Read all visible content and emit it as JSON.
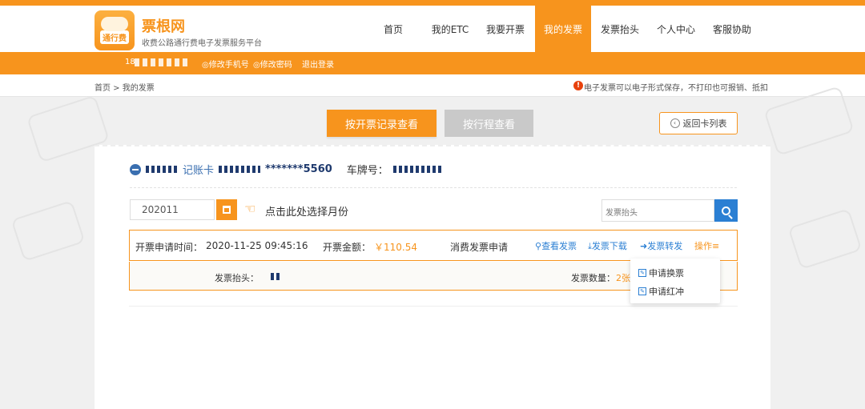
{
  "header": {
    "logo_text": "通行费",
    "brand": "票根网",
    "slogan": "收费公路通行费电子发票服务平台",
    "nav": [
      "首页",
      "我的ETC",
      "我要开票",
      "我的发票",
      "发票抬头",
      "个人中心",
      "客服协助"
    ],
    "active_nav": "我的发票"
  },
  "subbar": {
    "phone_prefix": "18",
    "change_phone": "◎修改手机号",
    "change_password": "◎修改密码",
    "logout": "退出登录"
  },
  "breadcrumb": {
    "text": "首页 > 我的发票"
  },
  "notice": {
    "icon": "!",
    "text": "电子发票可以电子形式保存，不打印也可报销、抵扣"
  },
  "buttons": {
    "by_record": "按开票记录查看",
    "by_trip": "按行程查看",
    "back": "返回卡列表"
  },
  "card_info": {
    "type": "记账卡",
    "number_suffix": "*******5560",
    "plate_label": "车牌号："
  },
  "filter": {
    "month_value": "202011",
    "hint": "点击此处选择月份",
    "search_placeholder": "发票抬头"
  },
  "record": {
    "apply_time_label": "开票申请时间：",
    "apply_time": "2020-11-25 09:45:16",
    "amount_label": "开票金额：",
    "amount": "￥110.54",
    "type": "消费发票申请",
    "actions": {
      "view": "查看发票",
      "download": "发票下载",
      "forward": "发票转发",
      "operate": "操作"
    },
    "title_label": "发票抬头：",
    "count_label": "发票数量：",
    "count_value": "2张"
  },
  "dropdown": {
    "items": [
      "申请换票",
      "申请红冲"
    ]
  },
  "colors": {
    "brand_orange": "#f7941d",
    "link_blue": "#2b7fd3",
    "button_gray": "#c9c9c9"
  }
}
